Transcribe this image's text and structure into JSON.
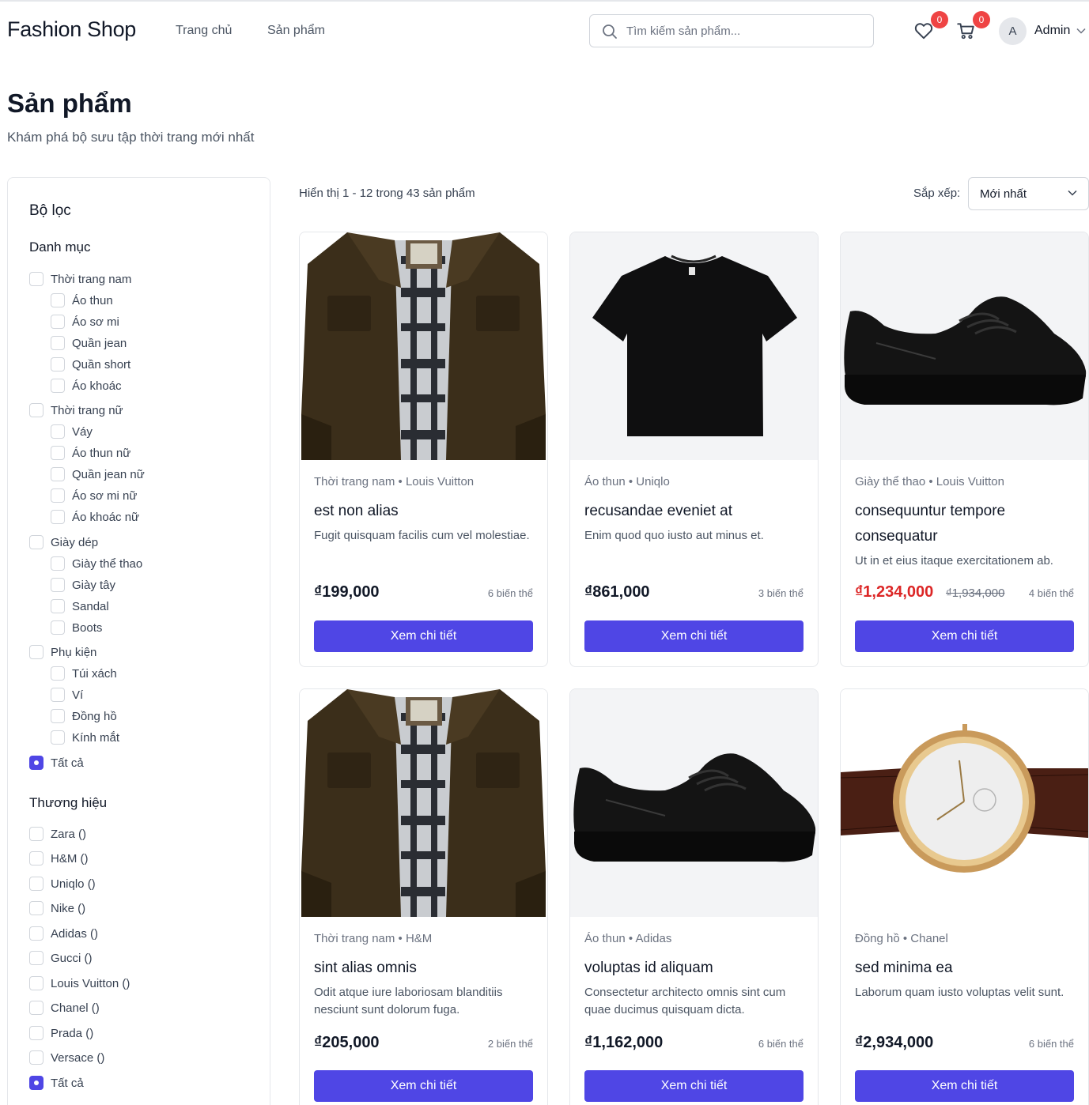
{
  "header": {
    "brand": "Fashion Shop",
    "nav": {
      "home": "Trang chủ",
      "products": "Sản phẩm"
    },
    "search_placeholder": "Tìm kiếm sản phẩm...",
    "wishlist_count": "0",
    "cart_count": "0",
    "avatar_initial": "A",
    "user_name": "Admin"
  },
  "page": {
    "title": "Sản phẩm",
    "subtitle": "Khám phá bộ sưu tập thời trang mới nhất"
  },
  "filters": {
    "title": "Bộ lọc",
    "category_title": "Danh mục",
    "categories": [
      {
        "label": "Thời trang nam",
        "level": 0,
        "checked": false
      },
      {
        "label": "Áo thun",
        "level": 1,
        "checked": false
      },
      {
        "label": "Áo sơ mi",
        "level": 1,
        "checked": false
      },
      {
        "label": "Quần jean",
        "level": 1,
        "checked": false
      },
      {
        "label": "Quần short",
        "level": 1,
        "checked": false
      },
      {
        "label": "Áo khoác",
        "level": 1,
        "checked": false
      },
      {
        "label": "Thời trang nữ",
        "level": 0,
        "checked": false
      },
      {
        "label": "Váy",
        "level": 1,
        "checked": false
      },
      {
        "label": "Áo thun nữ",
        "level": 1,
        "checked": false
      },
      {
        "label": "Quần jean nữ",
        "level": 1,
        "checked": false
      },
      {
        "label": "Áo sơ mi nữ",
        "level": 1,
        "checked": false
      },
      {
        "label": "Áo khoác nữ",
        "level": 1,
        "checked": false
      },
      {
        "label": "Giày dép",
        "level": 0,
        "checked": false
      },
      {
        "label": "Giày thể thao",
        "level": 1,
        "checked": false
      },
      {
        "label": "Giày tây",
        "level": 1,
        "checked": false
      },
      {
        "label": "Sandal",
        "level": 1,
        "checked": false
      },
      {
        "label": "Boots",
        "level": 1,
        "checked": false
      },
      {
        "label": "Phụ kiện",
        "level": 0,
        "checked": false
      },
      {
        "label": "Túi xách",
        "level": 1,
        "checked": false
      },
      {
        "label": "Ví",
        "level": 1,
        "checked": false
      },
      {
        "label": "Đồng hồ",
        "level": 1,
        "checked": false
      },
      {
        "label": "Kính mắt",
        "level": 1,
        "checked": false
      },
      {
        "label": "Tất cả",
        "level": 0,
        "checked": true
      }
    ],
    "brand_title": "Thương hiệu",
    "brands": [
      {
        "label": "Zara ()",
        "checked": false
      },
      {
        "label": "H&M ()",
        "checked": false
      },
      {
        "label": "Uniqlo ()",
        "checked": false
      },
      {
        "label": "Nike ()",
        "checked": false
      },
      {
        "label": "Adidas ()",
        "checked": false
      },
      {
        "label": "Gucci ()",
        "checked": false
      },
      {
        "label": "Louis Vuitton ()",
        "checked": false
      },
      {
        "label": "Chanel ()",
        "checked": false
      },
      {
        "label": "Prada ()",
        "checked": false
      },
      {
        "label": "Versace ()",
        "checked": false
      },
      {
        "label": "Tất cả",
        "checked": true
      }
    ]
  },
  "toolbar": {
    "showing": "Hiển thị 1 - 12 trong 43 sản phẩm",
    "sort_label": "Sắp xếp:",
    "sort_value": "Mới nhất"
  },
  "products": [
    {
      "image": "jacket-image",
      "meta": "Thời trang nam • Louis Vuitton",
      "name": "est non alias",
      "description": "Fugit quisquam facilis cum vel molestiae.",
      "price": "₫199,000",
      "old_price": "",
      "variants": "6 biến thể",
      "button": "Xem chi tiết"
    },
    {
      "image": "tshirt-image",
      "meta": "Áo thun • Uniqlo",
      "name": "recusandae eveniet at",
      "description": "Enim quod quo iusto aut minus et.",
      "price": "₫861,000",
      "old_price": "",
      "variants": "3 biến thể",
      "button": "Xem chi tiết"
    },
    {
      "image": "sneaker-image",
      "meta": "Giày thể thao • Louis Vuitton",
      "name": "consequuntur tempore consequatur",
      "description": "Ut in et eius itaque exercitationem ab.",
      "price": "₫1,234,000",
      "old_price": "₫1,934,000",
      "variants": "4 biến thể",
      "button": "Xem chi tiết"
    },
    {
      "image": "jacket-image",
      "meta": "Thời trang nam • H&M",
      "name": "sint alias omnis",
      "description": "Odit atque iure laboriosam blanditiis nesciunt sunt dolorum fuga.",
      "price": "₫205,000",
      "old_price": "",
      "variants": "2 biến thể",
      "button": "Xem chi tiết"
    },
    {
      "image": "sneaker-image",
      "meta": "Áo thun • Adidas",
      "name": "voluptas id aliquam",
      "description": "Consectetur architecto omnis sint cum quae ducimus quisquam dicta.",
      "price": "₫1,162,000",
      "old_price": "",
      "variants": "6 biến thể",
      "button": "Xem chi tiết"
    },
    {
      "image": "watch-image",
      "meta": "Đồng hồ • Chanel",
      "name": "sed minima ea",
      "description": "Laborum quam iusto voluptas velit sunt.",
      "price": "₫2,934,000",
      "old_price": "",
      "variants": "6 biến thể",
      "button": "Xem chi tiết"
    }
  ],
  "colors": {
    "primary": "#4f46e5",
    "badge": "#ef4444",
    "sale": "#dc2626"
  }
}
